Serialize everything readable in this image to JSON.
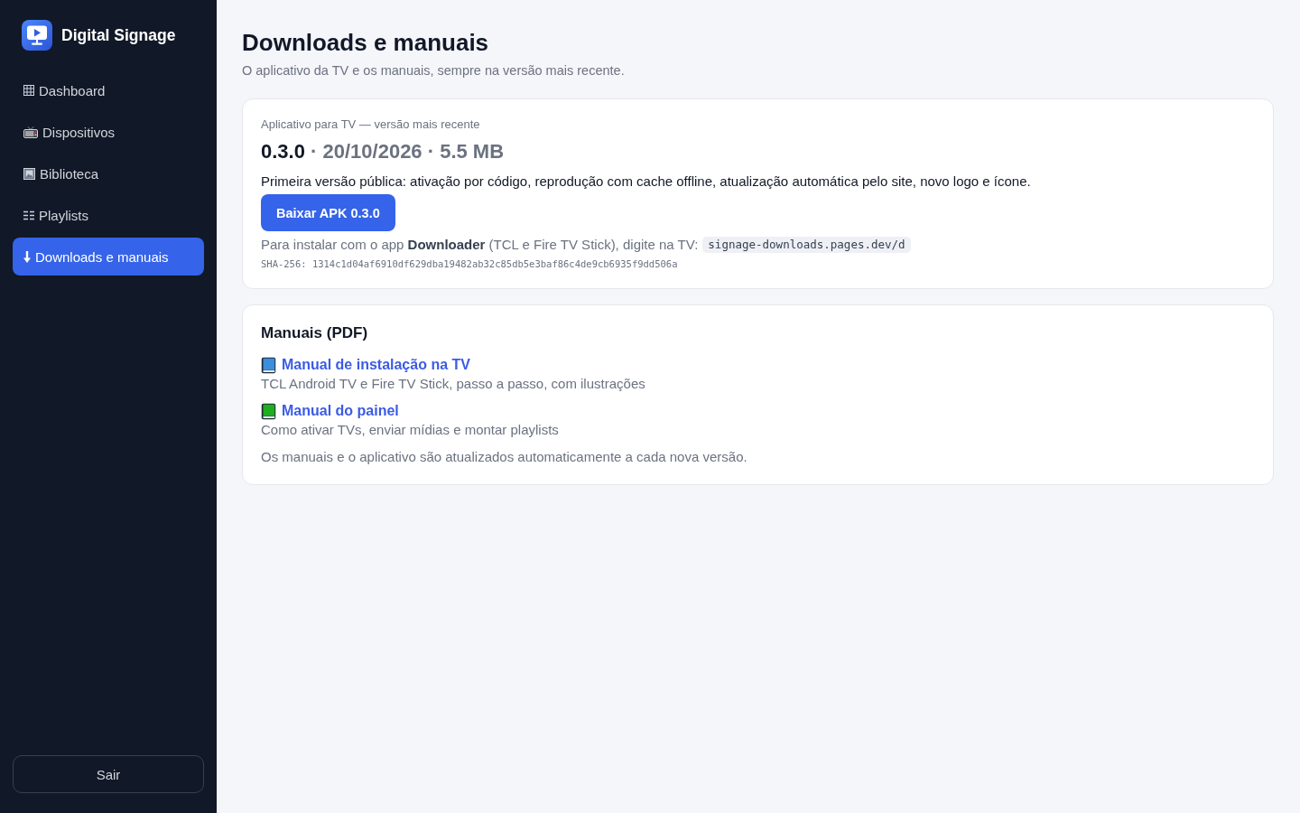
{
  "sidebar": {
    "brand": "Digital Signage",
    "items": [
      {
        "label": "Dashboard",
        "selected": false
      },
      {
        "label": "Dispositivos",
        "selected": false
      },
      {
        "label": "Biblioteca",
        "selected": false
      },
      {
        "label": "Playlists",
        "selected": false
      },
      {
        "label": "Downloads e manuais",
        "selected": true
      }
    ],
    "logout_button": "Sair"
  },
  "page": {
    "title": "Downloads e manuais",
    "subtitle": "O aplicativo da TV e os manuais, sempre na versão mais recente."
  },
  "app_card": {
    "caption": "Aplicativo para TV — versão mais recente",
    "version": "0.3.0",
    "details": "· 20/10/2026 · 5.5 MB",
    "description": "Primeira versão pública: ativação por código, reprodução com cache offline, atualização automática pelo site, novo logo e ícone.",
    "download_button": "Baixar APK 0.3.0",
    "install_hint": "Para instalar com o app **Downloader** (TCL e Fire TV Stick), digite na TV:",
    "install_url": "signage-downloads.pages.dev/d",
    "checksum": "SHA-256: 1314c1d04af6910df629dba19482ab32c85db5e3baf86c4de9cb6935f9dd506a"
  },
  "manuals_card": {
    "title": "Manuais (PDF)",
    "items": [
      {
        "title": "Manual de instalação na TV",
        "description": "TCL Android TV e Fire TV Stick, passo a passo, com ilustrações",
        "color": "#3b8ede"
      },
      {
        "title": "Manual do painel",
        "description": "Como ativar TVs, enviar mídias e montar playlists",
        "color": "#1fae1f"
      }
    ],
    "note": "Os manuais e o aplicativo são atualizados automaticamente a cada nova versão."
  }
}
